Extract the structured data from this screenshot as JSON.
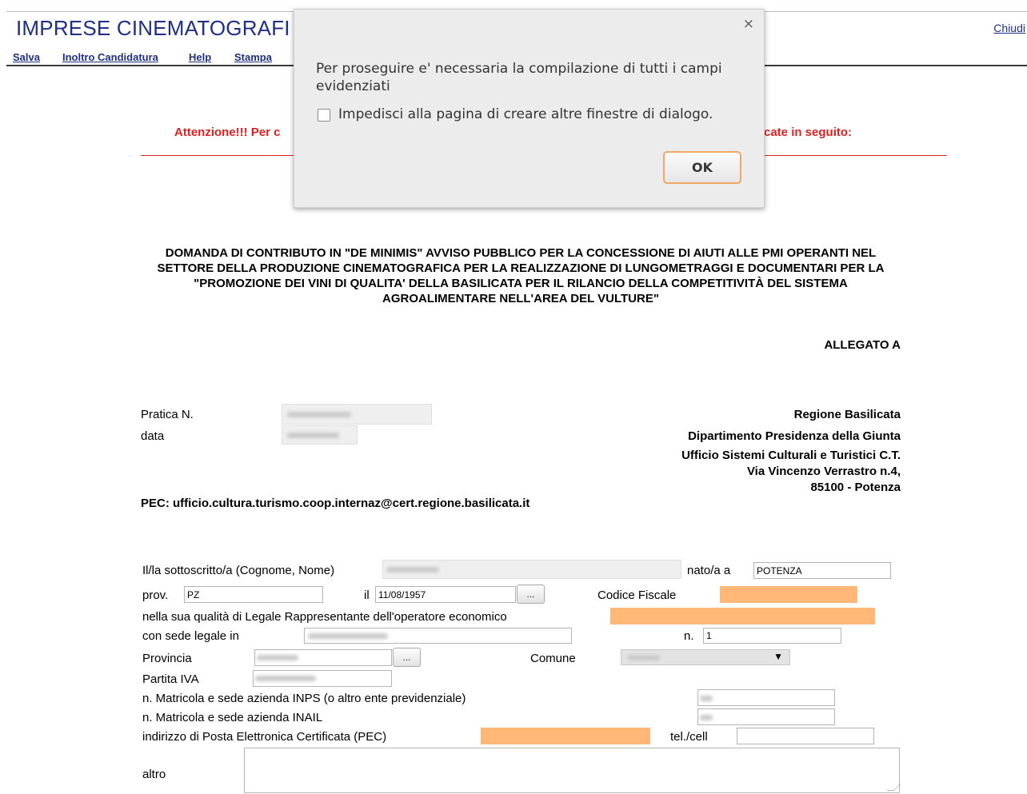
{
  "header": {
    "app_title": "IMPRESE CINEMATOGRAFI",
    "close_link": "Chiudi",
    "menu": [
      "Salva",
      "Inoltro Candidatura",
      "Help",
      "Stampa"
    ]
  },
  "notice": {
    "left": "Attenzione!!! Per c",
    "right": "cate in seguito:"
  },
  "document": {
    "heading": "DOMANDA DI CONTRIBUTO IN \"DE MINIMIS\" AVVISO PUBBLICO PER LA CONCESSIONE DI AIUTI ALLE PMI OPERANTI NEL SETTORE DELLA PRODUZIONE CINEMATOGRAFICA PER LA REALIZZAZIONE DI LUNGOMETRAGGI E DOCUMENTARI PER LA \"PROMOZIONE DEI VINI DI QUALITA' DELLA BASILICATA PER IL RILANCIO DELLA COMPETITIVITÀ DEL SISTEMA AGROALIMENTARE NELL'AREA DEL VULTURE\"",
    "allegato": "ALLEGATO A",
    "pratica_label": "Pratica N.",
    "data_label": "data",
    "recipient": [
      "Regione Basilicata",
      "Dipartimento Presidenza della Giunta",
      "Ufficio Sistemi Culturali e Turistici C.T.",
      "Via Vincenzo Verrastro n.4,",
      "85100 - Potenza"
    ],
    "pec_line": "PEC: ufficio.cultura.turismo.coop.internaz@cert.regione.basilicata.it"
  },
  "form": {
    "sottoscritto_label": "Il/la sottoscritto/a (Cognome, Nome)",
    "nato_label": "nato/a a",
    "nato_value": "POTENZA",
    "prov_label": "prov.",
    "prov_value": "PZ",
    "il_label": "il",
    "il_value": "11/08/1957",
    "picker_btn": "...",
    "cf_label": "Codice Fiscale",
    "qualita_label": "nella sua qualità di Legale Rappresentante dell'operatore economico",
    "sede_label": "con sede legale in",
    "n_label": "n.",
    "n_value": "1",
    "provincia_label": "Provincia",
    "comune_label": "Comune",
    "piva_label": "Partita IVA",
    "inps_label": "n. Matricola e sede azienda INPS (o altro ente previdenziale)",
    "inail_label": "n. Matricola e sede azienda INAIL",
    "pec_label": "indirizzo di Posta Elettronica Certificata (PEC)",
    "tel_label": "tel./cell",
    "altro_label": "altro",
    "comune_arrow": "▼"
  },
  "dialog": {
    "close": "×",
    "message": "Per proseguire e' necessaria la compilazione di tutti i campi evidenziati",
    "checkbox_label": "Impedisci alla pagina di creare altre finestre di dialogo.",
    "ok": "OK"
  },
  "colors": {
    "title_blue": "#1f2f86",
    "warning_red": "#e02020",
    "required_orange": "#ffb877"
  }
}
